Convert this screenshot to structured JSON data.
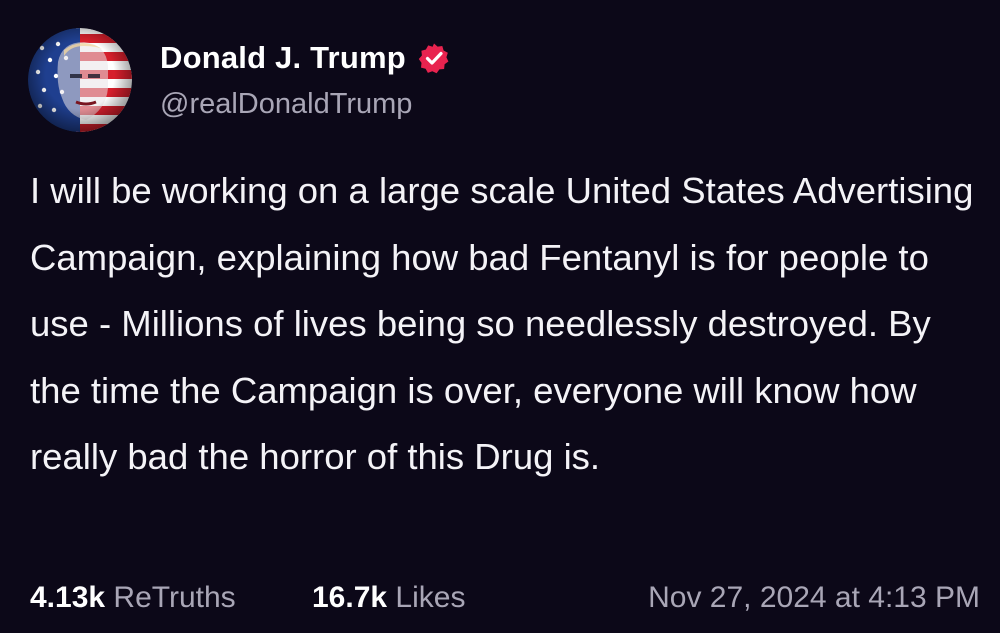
{
  "author": {
    "display_name": "Donald J. Trump",
    "handle": "@realDonaldTrump",
    "verified": true,
    "verified_badge_color": "#e8234f",
    "avatar_icon": "avatar-portrait-flag"
  },
  "post": {
    "text": "I will be working on a large scale United States Advertising Campaign, explaining how bad Fentanyl is for people to use - Millions of lives being so needlessly destroyed. By the time the Campaign is over, everyone will know how really bad the horror of this Drug is."
  },
  "stats": {
    "retruths_count": "4.13k",
    "retruths_label": "ReTruths",
    "likes_count": "16.7k",
    "likes_label": "Likes",
    "timestamp": "Nov 27, 2024 at 4:13 PM"
  },
  "colors": {
    "background": "#0c0818",
    "text_primary": "#ffffff",
    "text_secondary": "#a9a6b6"
  }
}
